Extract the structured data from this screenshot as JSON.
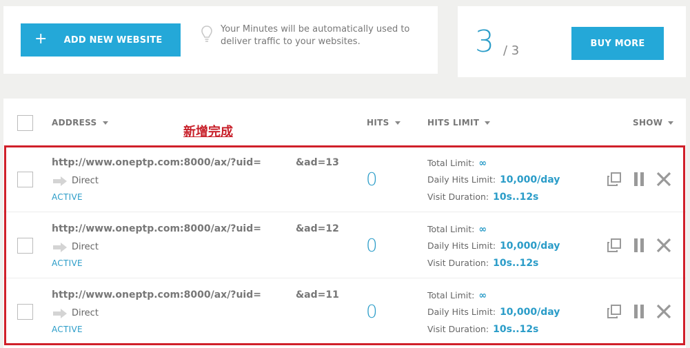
{
  "top": {
    "add_button": "ADD NEW WEBSITE",
    "add_icon": "+",
    "info_text": "Your Minutes will be automatically used to deliver traffic to your websites.",
    "count": "3",
    "count_total": "/ 3",
    "buy_button": "BUY MORE"
  },
  "table": {
    "headers": {
      "address": "ADDRESS",
      "hits": "HITS",
      "hits_limit": "HITS LIMIT",
      "show": "SHOW"
    },
    "annotation": "新增完成",
    "rows": [
      {
        "url_prefix": "http://www.oneptp.com:8000/ax/?uid=",
        "url_suffix": "&ad=13",
        "source": "Direct",
        "status": "ACTIVE",
        "hits": "0",
        "total_label": "Total Limit:",
        "total_value": "∞",
        "daily_label": "Daily Hits Limit:",
        "daily_value": "10,000/day",
        "duration_label": "Visit Duration:",
        "duration_value": "10s..12s"
      },
      {
        "url_prefix": "http://www.oneptp.com:8000/ax/?uid=",
        "url_suffix": "&ad=12",
        "source": "Direct",
        "status": "ACTIVE",
        "hits": "0",
        "total_label": "Total Limit:",
        "total_value": "∞",
        "daily_label": "Daily Hits Limit:",
        "daily_value": "10,000/day",
        "duration_label": "Visit Duration:",
        "duration_value": "10s..12s"
      },
      {
        "url_prefix": "http://www.oneptp.com:8000/ax/?uid=",
        "url_suffix": "&ad=11",
        "source": "Direct",
        "status": "ACTIVE",
        "hits": "0",
        "total_label": "Total Limit:",
        "total_value": "∞",
        "daily_label": "Daily Hits Limit:",
        "daily_value": "10,000/day",
        "duration_label": "Visit Duration:",
        "duration_value": "10s..12s"
      }
    ]
  },
  "colors": {
    "accent": "#24a8d8",
    "highlight": "#d0202a",
    "background": "#f0f0ee"
  },
  "icons": [
    "plus-icon",
    "lightbulb-icon",
    "arrow-right-icon",
    "copy-icon",
    "pause-icon",
    "close-icon"
  ]
}
